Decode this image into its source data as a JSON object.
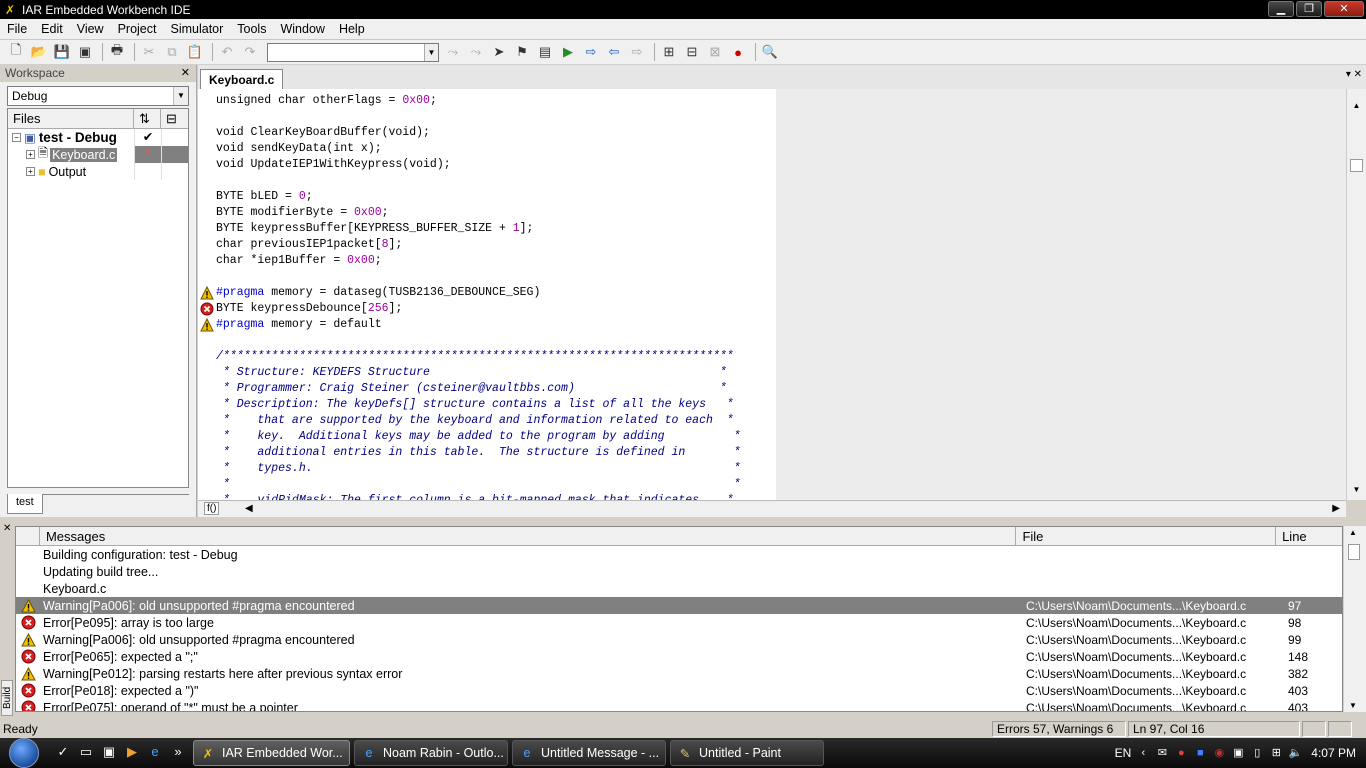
{
  "window": {
    "title": "IAR Embedded Workbench IDE"
  },
  "menu": [
    "File",
    "Edit",
    "View",
    "Project",
    "Simulator",
    "Tools",
    "Window",
    "Help"
  ],
  "workspace": {
    "header": "Workspace",
    "config": "Debug",
    "columns": {
      "files": "Files"
    },
    "tree": [
      {
        "label": "test - Debug",
        "check": "✔"
      },
      {
        "label": "Keyboard.c",
        "mark": "*"
      },
      {
        "label": "Output"
      }
    ],
    "tab": "test"
  },
  "editor": {
    "tab": "Keyboard.c",
    "func_btn": "f()",
    "lines": [
      [
        {
          "t": "unsigned char otherFlags = "
        },
        {
          "t": "0x00",
          "c": "num"
        },
        {
          "t": ";"
        }
      ],
      [],
      [
        {
          "t": "void ClearKeyBoardBuffer(void);"
        }
      ],
      [
        {
          "t": "void sendKeyData(int x);"
        }
      ],
      [
        {
          "t": "void UpdateIEP1WithKeypress(void);"
        }
      ],
      [],
      [
        {
          "t": "BYTE bLED = "
        },
        {
          "t": "0",
          "c": "num"
        },
        {
          "t": ";"
        }
      ],
      [
        {
          "t": "BYTE modifierByte = "
        },
        {
          "t": "0x00",
          "c": "num"
        },
        {
          "t": ";"
        }
      ],
      [
        {
          "t": "BYTE keypressBuffer[KEYPRESS_BUFFER_SIZE + "
        },
        {
          "t": "1",
          "c": "num"
        },
        {
          "t": "];"
        }
      ],
      [
        {
          "t": "char previousIEP1packet["
        },
        {
          "t": "8",
          "c": "num"
        },
        {
          "t": "];"
        }
      ],
      [
        {
          "t": "char *iep1Buffer = "
        },
        {
          "t": "0x00",
          "c": "num"
        },
        {
          "t": ";"
        }
      ],
      [],
      [
        {
          "t": "#pragma",
          "c": "pre"
        },
        {
          "t": " memory = dataseg(TUSB2136_DEBOUNCE_SEG)"
        }
      ],
      [
        {
          "t": "BYTE keypressDebounce["
        },
        {
          "t": "256",
          "c": "num"
        },
        {
          "t": "];"
        }
      ],
      [
        {
          "t": "#pragma",
          "c": "pre"
        },
        {
          "t": " memory = default"
        }
      ],
      [],
      [
        {
          "t": "/**************************************************************************",
          "c": "cmt"
        }
      ],
      [
        {
          "t": " * Structure: KEYDEFS Structure                                          *",
          "c": "cmt"
        }
      ],
      [
        {
          "t": " * Programmer: Craig Steiner (csteiner@vaultbbs.com)                     *",
          "c": "cmt"
        }
      ],
      [
        {
          "t": " * Description: The keyDefs[] structure contains a list of all the keys   *",
          "c": "cmt"
        }
      ],
      [
        {
          "t": " *    that are supported by the keyboard and information related to each  *",
          "c": "cmt"
        }
      ],
      [
        {
          "t": " *    key.  Additional keys may be added to the program by adding          *",
          "c": "cmt"
        }
      ],
      [
        {
          "t": " *    additional entries in this table.  The structure is defined in       *",
          "c": "cmt"
        }
      ],
      [
        {
          "t": " *    types.h.                                                             *",
          "c": "cmt"
        }
      ],
      [
        {
          "t": " *                                                                         *",
          "c": "cmt"
        }
      ],
      [
        {
          "t": " *    vidPidMask: The first column is a bit-mapped mask that indicates    *",
          "c": "cmt"
        }
      ]
    ]
  },
  "messages": {
    "columns": {
      "messages": "Messages",
      "file": "File",
      "line": "Line"
    },
    "side_tab": "Build",
    "rows": [
      {
        "type": "",
        "text": "Building configuration: test - Debug",
        "file": "",
        "line": ""
      },
      {
        "type": "",
        "text": "Updating build tree...",
        "file": "",
        "line": ""
      },
      {
        "type": "",
        "text": "Keyboard.c",
        "file": "",
        "line": ""
      },
      {
        "type": "warning",
        "text": "Warning[Pa006]: old unsupported #pragma encountered",
        "file": "C:\\Users\\Noam\\Documents...\\Keyboard.c",
        "line": "97",
        "selected": true
      },
      {
        "type": "error",
        "text": "Error[Pe095]: array is too large",
        "file": "C:\\Users\\Noam\\Documents...\\Keyboard.c",
        "line": "98"
      },
      {
        "type": "warning",
        "text": "Warning[Pa006]: old unsupported #pragma encountered",
        "file": "C:\\Users\\Noam\\Documents...\\Keyboard.c",
        "line": "99"
      },
      {
        "type": "error",
        "text": "Error[Pe065]: expected a \";\"",
        "file": "C:\\Users\\Noam\\Documents...\\Keyboard.c",
        "line": "148"
      },
      {
        "type": "warning",
        "text": "Warning[Pe012]: parsing restarts here after previous syntax error",
        "file": "C:\\Users\\Noam\\Documents...\\Keyboard.c",
        "line": "382"
      },
      {
        "type": "error",
        "text": "Error[Pe018]: expected a \")\"",
        "file": "C:\\Users\\Noam\\Documents...\\Keyboard.c",
        "line": "403"
      },
      {
        "type": "error",
        "text": "Error[Pe075]: operand of \"*\" must be a pointer",
        "file": "C:\\Users\\Noam\\Documents...\\Keyboard.c",
        "line": "403"
      }
    ]
  },
  "status": {
    "ready": "Ready",
    "errors": "Errors 57, Warnings 6",
    "position": "Ln 97, Col 16"
  },
  "taskbar": {
    "tasks": [
      {
        "label": "IAR Embedded Wor...",
        "icon": "iar-icon"
      },
      {
        "label": "Noam Rabin - Outlo...",
        "icon": "ie-icon"
      },
      {
        "label": "Untitled Message - ...",
        "icon": "ie-icon"
      },
      {
        "label": "Untitled - Paint",
        "icon": "paint-icon"
      }
    ],
    "lang": "EN",
    "time": "4:07 PM"
  },
  "colors": {
    "warning": "#f0c000",
    "error": "#d42020",
    "selection": "#808080"
  }
}
